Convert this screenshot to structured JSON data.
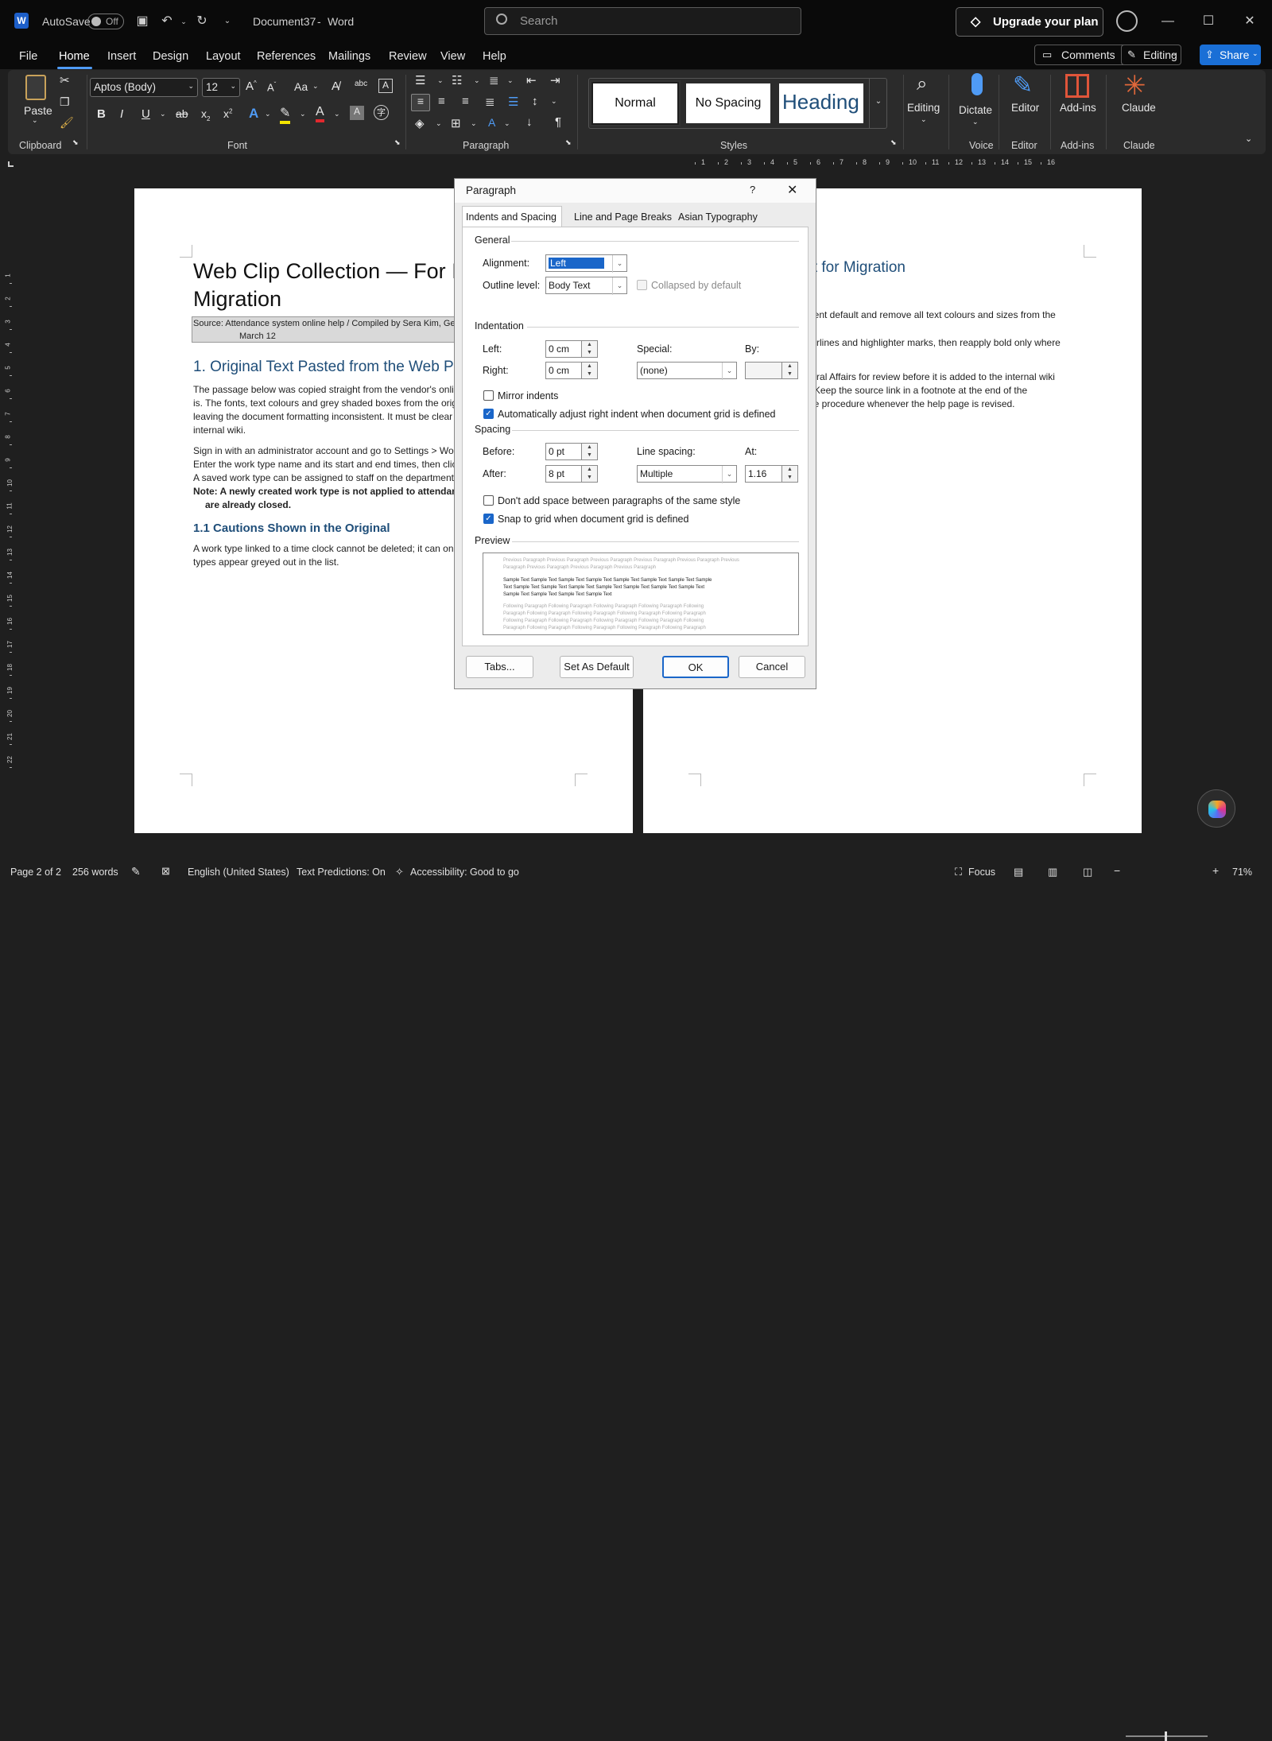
{
  "titlebar": {
    "autosave_label": "AutoSave",
    "autosave_state": "Off",
    "doc_title": "Document37",
    "app_name": "Word",
    "title_sep": "-",
    "search_placeholder": "Search",
    "upgrade_label": "Upgrade your plan"
  },
  "menu": {
    "items": [
      "File",
      "Home",
      "Insert",
      "Design",
      "Layout",
      "References",
      "Mailings",
      "Review",
      "View",
      "Help"
    ],
    "comments": "Comments",
    "editing": "Editing",
    "share": "Share"
  },
  "ribbon": {
    "clipboard": {
      "paste": "Paste",
      "label": "Clipboard"
    },
    "font": {
      "name": "Aptos (Body)",
      "size": "12",
      "label": "Font",
      "bold": "B",
      "italic": "I",
      "underline": "U",
      "strike": "ab",
      "sub": "x",
      "sup": "x",
      "case": "Aa"
    },
    "paragraph": {
      "label": "Paragraph"
    },
    "styles": {
      "label": "Styles",
      "cards": [
        "Normal",
        "No Spacing",
        "Heading 1"
      ]
    },
    "editing": {
      "label": "Editing"
    },
    "voice": {
      "dictate": "Dictate",
      "label": "Voice"
    },
    "editor": {
      "btn": "Editor",
      "label": "Editor"
    },
    "addins": {
      "btn": "Add-ins",
      "label": "Add-ins"
    },
    "claude": {
      "btn": "Claude",
      "label": "Claude"
    }
  },
  "ruler": {
    "numbers": [
      "1",
      "2",
      "3",
      "4",
      "5",
      "6",
      "7",
      "8",
      "9",
      "10",
      "11",
      "12",
      "13",
      "14",
      "15",
      "16"
    ],
    "left_numbers": [
      "1",
      "2",
      "3",
      "4",
      "5",
      "6",
      "7",
      "8",
      "9",
      "10",
      "11",
      "12",
      "13",
      "14",
      "15",
      "16",
      "17",
      "18",
      "19",
      "20",
      "21",
      "22"
    ]
  },
  "page1": {
    "title_line1": "Web Clip Collection — For Int",
    "title_line2": "Migration",
    "source_line1": "Source: Attendance system online help / Compiled by Sera Kim, Ge",
    "source_line2": "March 12",
    "h1": "1. Original Text Pasted from the Web Pag",
    "para1": [
      "The passage below was copied straight from the vendor's onlin",
      "is. The fonts, text colours and grey shaded boxes from the origi",
      "leaving the document formatting inconsistent. It must be clear",
      "internal wiki."
    ],
    "para2": [
      "Sign in with an administrator account and go to Settings > Worl",
      "Enter the work type name and its start and end times, then clic",
      "A saved work type can be assigned to staff on the department a"
    ],
    "note_line1": "Note: A newly created work type is not applied to attendanc",
    "note_line2": "are already closed.",
    "h2": "1.1 Cautions Shown in the Original",
    "para3": [
      "A work type linked to a time clock cannot be deleted; it can onl",
      "types appear greyed out in the list."
    ]
  },
  "page2": {
    "heading": "aft for Migration",
    "lines": [
      "ument default and remove all text colours and sizes from the",
      "nderlines and highlighter marks, then reapply bold only where",
      "eneral Affairs for review before it is added to the internal wiki",
      "s\". Keep the source link in a footnote at the end of the",
      "ame procedure whenever the help page is revised."
    ]
  },
  "dialog": {
    "title": "Paragraph",
    "help": "?",
    "tabs": [
      "Indents and Spacing",
      "Line and Page Breaks",
      "Asian Typography"
    ],
    "general": "General",
    "alignment_label": "Alignment:",
    "alignment_value": "Left",
    "outline_label": "Outline level:",
    "outline_value": "Body Text",
    "collapsed_label": "Collapsed by default",
    "indentation": "Indentation",
    "left_label": "Left:",
    "left_value": "0 cm",
    "right_label": "Right:",
    "right_value": "0 cm",
    "special_label": "Special:",
    "special_value": "(none)",
    "by_label": "By:",
    "by_value": "",
    "mirror_label": "Mirror indents",
    "auto_adjust_label": "Automatically adjust right indent when document grid is defined",
    "spacing": "Spacing",
    "before_label": "Before:",
    "before_value": "0 pt",
    "after_label": "After:",
    "after_value": "8 pt",
    "line_spacing_label": "Line spacing:",
    "line_spacing_value": "Multiple",
    "at_label": "At:",
    "at_value": "1.16",
    "dont_add_label": "Don't add space between paragraphs of the same style",
    "snap_label": "Snap to grid when document grid is defined",
    "preview": "Preview",
    "preview_prev": [
      "Previous Paragraph Previous Paragraph Previous Paragraph Previous Paragraph Previous Paragraph Previous",
      "Paragraph Previous Paragraph Previous Paragraph Previous Paragraph"
    ],
    "preview_sample": [
      "Sample Text Sample Text Sample Text Sample Text Sample Text Sample Text Sample Text Sample",
      "Text Sample Text Sample Text Sample Text Sample Text Sample Text Sample Text Sample Text",
      "Sample Text Sample Text Sample Text Sample Text"
    ],
    "preview_follow": [
      "Following Paragraph Following Paragraph Following Paragraph Following Paragraph Following",
      "Paragraph Following Paragraph Following Paragraph Following Paragraph Following Paragraph",
      "Following Paragraph Following Paragraph Following Paragraph Following Paragraph Following",
      "Paragraph Following Paragraph Following Paragraph Following Paragraph Following Paragraph"
    ],
    "tabs_btn": "Tabs...",
    "default_btn": "Set As Default",
    "ok_btn": "OK",
    "cancel_btn": "Cancel"
  },
  "status": {
    "page": "Page 2 of 2",
    "words": "256 words",
    "language": "English (United States)",
    "predictions": "Text Predictions: On",
    "accessibility": "Accessibility: Good to go",
    "focus": "Focus",
    "zoom": "71%"
  },
  "colors": {
    "accent": "#4f9bf5",
    "share": "#1a6fd6",
    "heading": "#1f4e79"
  }
}
